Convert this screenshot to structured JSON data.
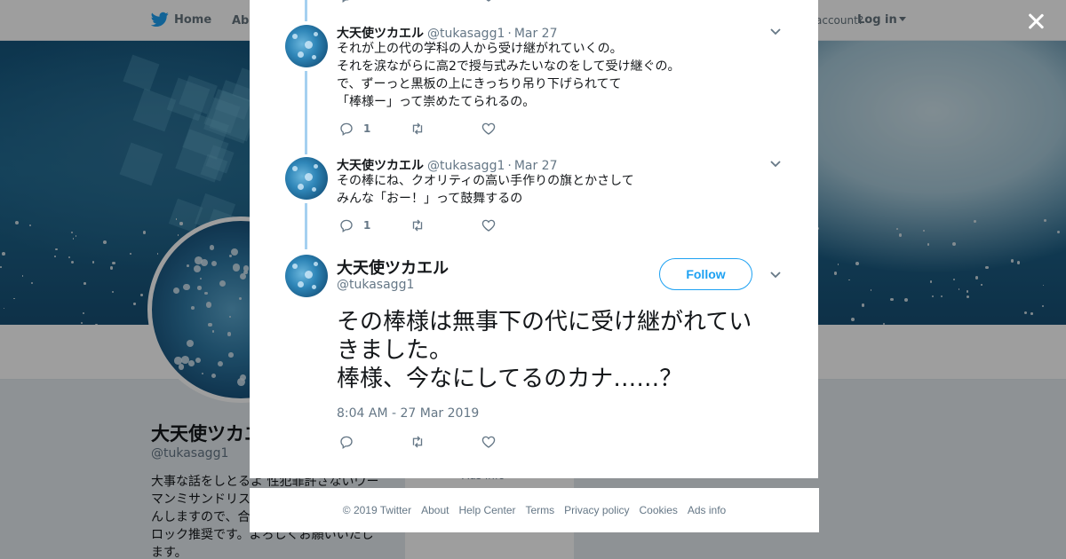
{
  "topbar": {
    "home_label": "Home",
    "about_label": "Abo",
    "account_text": "account?",
    "login_label": "Log in"
  },
  "profile": {
    "name": "大天使ツカエ",
    "handle": "@tukasagg1",
    "bio_lines": [
      "大事な話をしとるよ 性犯罪許さないウー",
      "マンミサンドリス",
      "んしますので、合",
      "ロック推奨です。よろしくお願いいたし",
      "ます。"
    ],
    "mid_text": "Aus info"
  },
  "thread": [
    {
      "name": "大天使ツカエル",
      "handle": "@tukasagg1",
      "separator": "·",
      "date": "Mar 27",
      "lines": [
        "それが上の代の学科の人から受け継がれていくの。",
        "それを涙ながらに高2で授与式みたいなのをして受け継ぐの。",
        "で、ずーっと黒板の上にきっちり吊り下げられてて",
        "「棒様ー」って崇めたてられるの。"
      ],
      "reply_count": "1"
    },
    {
      "name": "大天使ツカエル",
      "handle": "@tukasagg1",
      "separator": "·",
      "date": "Mar 27",
      "lines": [
        "その棒にね、クオリティの高い手作りの旗とかさして",
        "みんな「おー！」って鼓舞するの"
      ],
      "reply_count": "1"
    }
  ],
  "main_tweet": {
    "name": "大天使ツカエル",
    "handle": "@tukasagg1",
    "follow_label": "Follow",
    "lines": [
      "その棒様は無事下の代に受け継がれてい",
      "きました。",
      "棒様、今なにしてるのカナ……？"
    ],
    "timestamp": "8:04 AM - 27 Mar 2019"
  },
  "footer": {
    "links": [
      "© 2019 Twitter",
      "About",
      "Help Center",
      "Terms",
      "Privacy policy",
      "Cookies",
      "Ads info"
    ]
  },
  "icons": {
    "brand": "twitter-bird-icon",
    "reply": "reply-icon",
    "retweet": "retweet-icon",
    "like": "heart-icon",
    "more": "chevron-down-icon",
    "close": "close-icon"
  },
  "colors": {
    "brand_blue": "#1da1f2",
    "thread_line": "#a5d0f0",
    "muted_text": "#657786"
  }
}
